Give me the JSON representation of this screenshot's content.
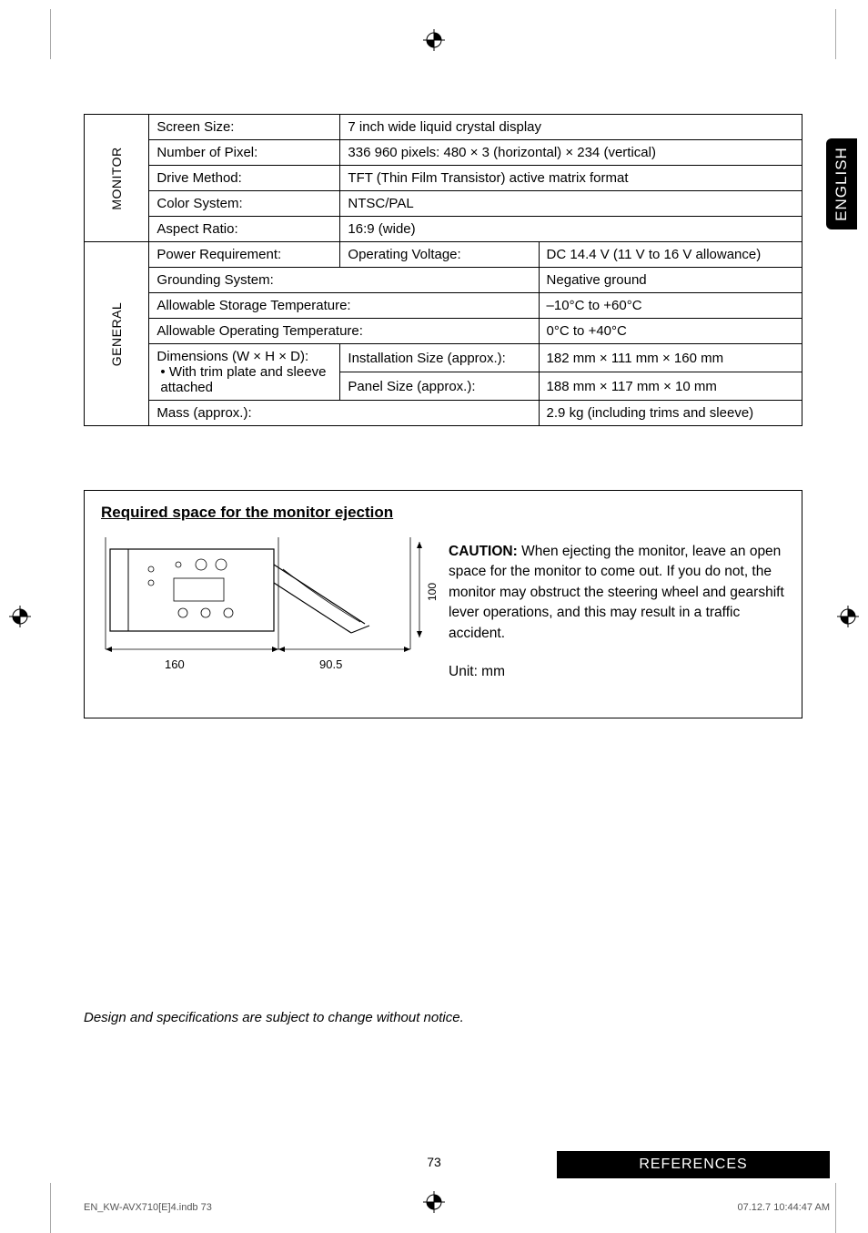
{
  "sidetab": "ENGLISH",
  "monitor": {
    "header": "MONITOR",
    "rows": [
      {
        "label": "Screen Size:",
        "value": "7 inch wide liquid crystal display"
      },
      {
        "label": "Number of Pixel:",
        "value": "336 960 pixels: 480 × 3 (horizontal) × 234 (vertical)"
      },
      {
        "label": "Drive Method:",
        "value": "TFT (Thin Film Transistor) active matrix format"
      },
      {
        "label": "Color System:",
        "value": "NTSC/PAL"
      },
      {
        "label": "Aspect Ratio:",
        "value": "16:9 (wide)"
      }
    ]
  },
  "general": {
    "header": "GENERAL",
    "power": {
      "label": "Power Requirement:",
      "sub": "Operating Voltage:",
      "value": "DC 14.4 V (11 V to 16 V allowance)"
    },
    "grounding": {
      "label": "Grounding System:",
      "value": "Negative ground"
    },
    "storage": {
      "label": "Allowable Storage Temperature:",
      "value": "–10°C to +60°C"
    },
    "operating": {
      "label": "Allowable Operating Temperature:",
      "value": "0°C to +40°C"
    },
    "dimensions": {
      "label": "Dimensions (W × H × D):",
      "bullet": "With trim plate and sleeve attached",
      "install": {
        "label": "Installation Size (approx.):",
        "value": "182 mm × 111 mm × 160 mm"
      },
      "panel": {
        "label": "Panel Size (approx.):",
        "value": "188 mm × 117 mm × 10 mm"
      }
    },
    "mass": {
      "label": "Mass (approx.):",
      "value": "2.9 kg (including trims and sleeve)"
    }
  },
  "diagram": {
    "title": "Required space for the monitor ejection",
    "dim160": "160",
    "dim905": "90.5",
    "dim100": "100",
    "caution_label": "CAUTION:",
    "caution_text": " When ejecting the monitor, leave an open space for the monitor to come out. If you do not, the monitor may obstruct the steering wheel and gearshift lever operations, and this may result in a traffic accident.",
    "unit": "Unit: mm"
  },
  "notice": "Design and specifications are subject to change without notice.",
  "pagenum": "73",
  "references": "REFERENCES",
  "footer_left": "EN_KW-AVX710[E]4.indb   73",
  "footer_right": "07.12.7   10:44:47 AM"
}
